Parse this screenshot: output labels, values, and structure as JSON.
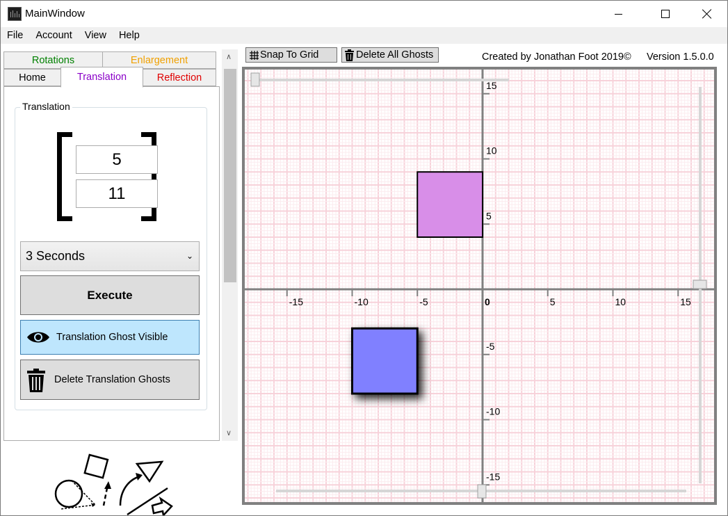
{
  "window": {
    "title": "MainWindow",
    "minimize_icon": "minimize-icon",
    "maximize_icon": "maximize-icon",
    "close_icon": "close-icon"
  },
  "menu": [
    "File",
    "Account",
    "View",
    "Help"
  ],
  "tabs": {
    "rotations": "Rotations",
    "enlargement": "Enlargement",
    "home": "Home",
    "translation": "Translation",
    "reflection": "Reflection",
    "active": "Translation"
  },
  "translation_panel": {
    "group_title": "Translation",
    "vector_x": "5",
    "vector_y": "11",
    "duration_selected": "3 Seconds",
    "execute_label": "Execute",
    "ghost_toggle_label": "Translation Ghost Visible",
    "delete_ghosts_label": "Delete Translation Ghosts"
  },
  "toolbar": {
    "snap_label": "Snap To Grid",
    "delete_all_label": "Delete All Ghosts",
    "credit": "Created by Jonathan Foot 2019©",
    "version": "Version 1.5.0.0"
  },
  "grid": {
    "x_min": -18,
    "x_max": 18,
    "y_min": -16,
    "y_max": 17,
    "x_ticks": [
      "-15",
      "-10",
      "-5",
      "0",
      "5",
      "10",
      "15"
    ],
    "y_ticks": [
      "15",
      "10",
      "5",
      "-5",
      "-10",
      "-15"
    ],
    "shapes": [
      {
        "name": "ghost-square",
        "x": [
          -5,
          0
        ],
        "y": [
          4,
          9
        ],
        "fill": "#d88ee8"
      },
      {
        "name": "blue-square",
        "x": [
          -10,
          -5
        ],
        "y": [
          -8,
          -3
        ],
        "fill": "#8080ff"
      }
    ]
  },
  "colors": {
    "rotations_tab": "#008000",
    "enlargement_tab": "#f0a000",
    "translation_tab": "#8a00c8",
    "reflection_tab": "#e00000",
    "grid_line": "#fadbe0",
    "axis": "#808080"
  }
}
